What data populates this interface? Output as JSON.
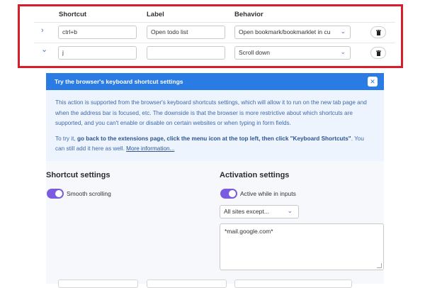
{
  "table": {
    "headers": {
      "shortcut": "Shortcut",
      "label": "Label",
      "behavior": "Behavior"
    },
    "rows": [
      {
        "chevron": "›",
        "shortcut": "ctrl+b",
        "label": "Open todo list",
        "behavior": "Open bookmark/bookmarklet in cu"
      },
      {
        "chevron": "⌄",
        "shortcut": "j",
        "label": "",
        "behavior": "Scroll down"
      }
    ]
  },
  "banner": {
    "title": "Try the browser's keyboard shortcut settings",
    "close": "✕"
  },
  "info": {
    "p1": "This action is supported from the browser's keyboard shortcuts settings, which will allow it to run on the new tab page and when the address bar is focused, etc. The downside is that the browser is more restrictive about which shortcuts are supported, and you can't enable or disable on certain websites or when typing in form fields.",
    "p2_prefix": "To try it, ",
    "p2_bold": "go back to the extensions page, click the menu icon at the top left, then click \"Keyboard Shortcuts\"",
    "p2_mid": ". You can still add it here as well. ",
    "p2_link": "More information..."
  },
  "shortcut_settings": {
    "title": "Shortcut settings",
    "smooth_scrolling": {
      "label": "Smooth scrolling",
      "on": true
    }
  },
  "activation_settings": {
    "title": "Activation settings",
    "active_in_inputs": {
      "label": "Active while in inputs",
      "on": true
    },
    "sites_select": "All sites except...",
    "sites_list": "*mail.google.com*"
  },
  "colors": {
    "accent": "#2a7be4",
    "toggle": "#7b5be0",
    "highlight": "#d91c2a"
  }
}
